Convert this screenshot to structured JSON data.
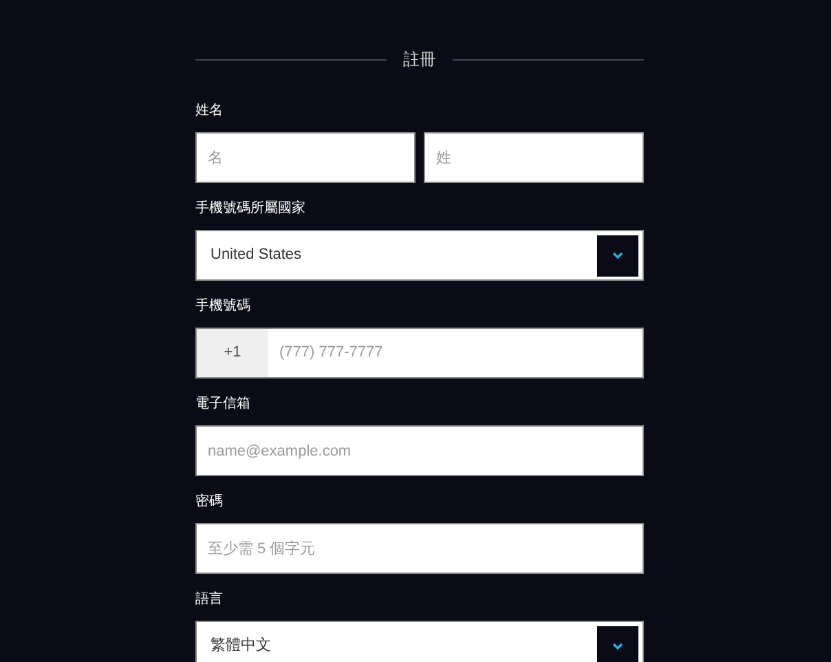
{
  "heading": "註冊",
  "fields": [
    {
      "kind": "pair",
      "label": "姓名",
      "placeholders": [
        "名",
        "姓"
      ]
    },
    {
      "kind": "select",
      "label": "手機號碼所屬國家",
      "value": "United States"
    },
    {
      "kind": "phone",
      "label": "手機號碼",
      "prefix": "+1",
      "placeholder": "(777) 777-7777"
    },
    {
      "kind": "text",
      "label": "電子信箱",
      "placeholder": "name@example.com"
    },
    {
      "kind": "text",
      "label": "密碼",
      "placeholder": "至少需 5 個字元"
    },
    {
      "kind": "select",
      "label": "語言",
      "value": "繁體中文"
    }
  ]
}
